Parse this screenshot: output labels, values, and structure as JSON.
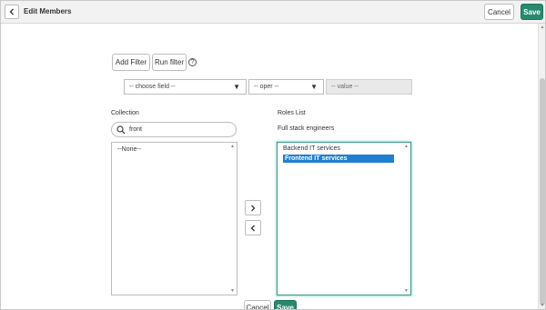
{
  "header": {
    "title": "Edit Members",
    "cancel_label": "Cancel",
    "save_label": "Save"
  },
  "filter": {
    "add_filter_label": "Add Filter",
    "run_filter_label": "Run filter",
    "field_select": "-- choose field --",
    "oper_select": "-- oper --",
    "value_placeholder": "-- value --"
  },
  "collection": {
    "label": "Collection",
    "search_value": "front",
    "items": [
      "--None--"
    ]
  },
  "roles": {
    "label": "Roles List",
    "group_name": "Full stack engineers",
    "items": [
      "Backend IT services",
      "Frontend IT services"
    ],
    "selected_index": 1
  },
  "footer": {
    "cancel_label": "Cancel",
    "save_label": "Save"
  },
  "icons": {
    "back": "chevron-left-icon",
    "help": "question-circle-icon",
    "search": "search-icon",
    "add": "chevron-right-icon",
    "remove": "chevron-left-icon"
  },
  "colors": {
    "primary": "#278a6e",
    "selection": "#1f7fd0",
    "focus_border": "#3a9d8a"
  }
}
